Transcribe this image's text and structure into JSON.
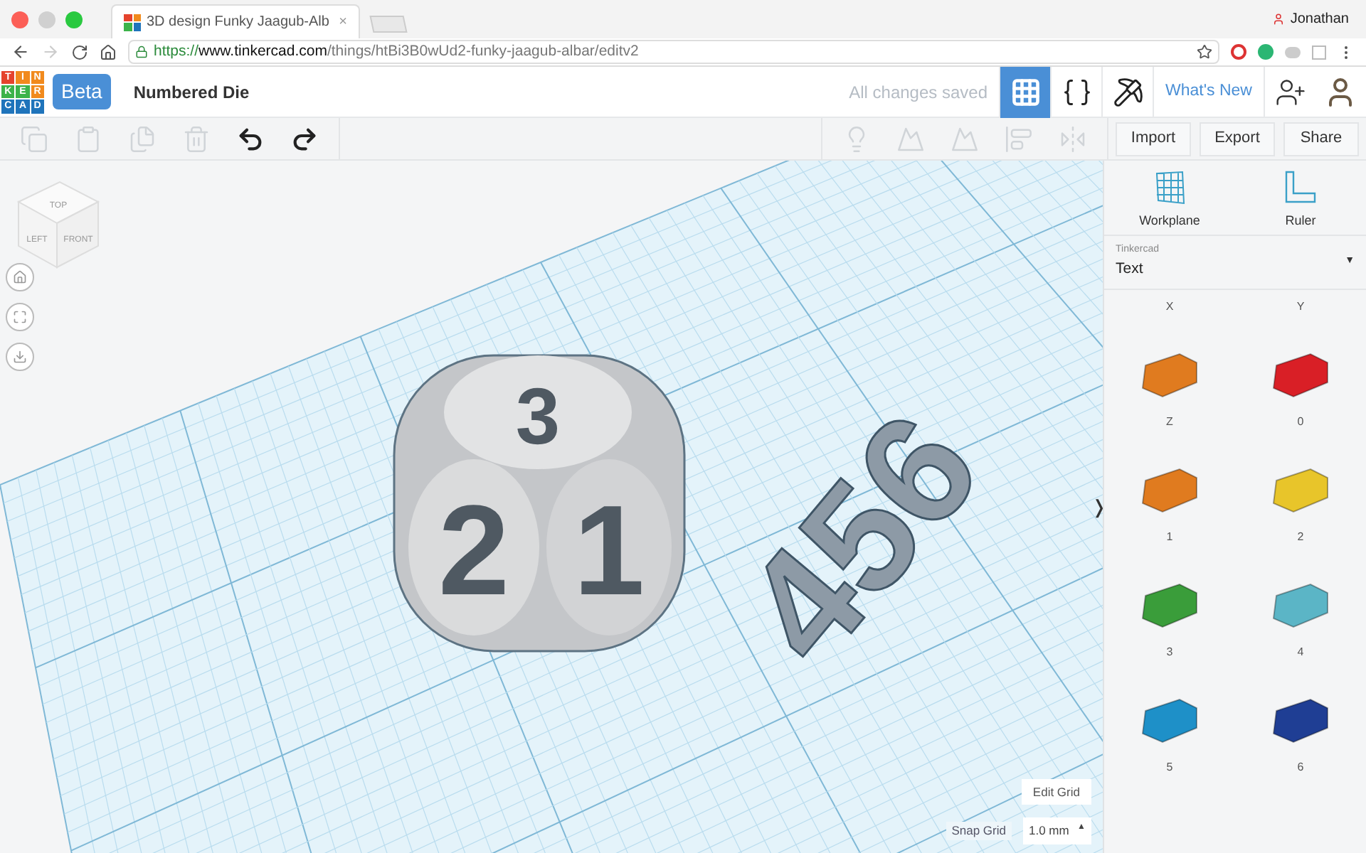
{
  "browser": {
    "tab_title": "3D design Funky Jaagub-Alb",
    "tab_close": "×",
    "profile": "Jonathan",
    "url_scheme": "https://",
    "url_host": "www.tinkercad.com",
    "url_path": "/things/htBi3B0wUd2-funky-jaagub-albar/editv2",
    "forward_disabled": true
  },
  "header": {
    "logo_letters": [
      "T",
      "I",
      "N",
      "K",
      "E",
      "R",
      "C",
      "A",
      "D"
    ],
    "badge": "Beta",
    "title": "Numbered Die",
    "save_status": "All changes saved",
    "whats_new": "What's New",
    "views": [
      {
        "kind": "grid",
        "selected": true
      },
      {
        "kind": "code",
        "selected": false
      },
      {
        "kind": "pickaxe",
        "selected": false
      }
    ]
  },
  "toolbar": {
    "edit_tools": [
      {
        "kind": "copy",
        "disabled": true
      },
      {
        "kind": "paste",
        "disabled": true
      },
      {
        "kind": "duplicate",
        "disabled": true
      },
      {
        "kind": "delete",
        "disabled": true
      },
      {
        "kind": "undo",
        "disabled": false
      },
      {
        "kind": "redo",
        "disabled": false
      }
    ],
    "shape_tools": [
      {
        "kind": "bulb",
        "disabled": true
      },
      {
        "kind": "solid",
        "disabled": true
      },
      {
        "kind": "hole",
        "disabled": true
      },
      {
        "kind": "align",
        "disabled": true
      },
      {
        "kind": "mirror",
        "disabled": true
      }
    ],
    "actions": [
      "Import",
      "Export",
      "Share"
    ]
  },
  "canvas": {
    "view_cube": [
      "TOP",
      "LEFT",
      "FRONT"
    ],
    "die_faces": [
      "3",
      "2",
      "1"
    ],
    "loose_digits": "456",
    "edit_grid": "Edit Grid",
    "snap_grid_label": "Snap Grid",
    "snap_grid_value": "1.0 mm",
    "snap_caret": "▲",
    "collapse": "❭"
  },
  "panel": {
    "tools": [
      "Workplane",
      "Ruler"
    ],
    "library_source": "Tinkercad",
    "library": "Text",
    "library_caret": "▼",
    "shapes": [
      {
        "label": "X",
        "kind": "label"
      },
      {
        "label": "Y",
        "kind": "label"
      },
      {
        "label": "Z",
        "kind": "shape",
        "color": "#e07b1f"
      },
      {
        "label": "0",
        "kind": "shape",
        "color": "#d91f26"
      },
      {
        "label": "1",
        "kind": "shape",
        "color": "#e07b1f"
      },
      {
        "label": "2",
        "kind": "shape",
        "color": "#e8c52a"
      },
      {
        "label": "3",
        "kind": "shape",
        "color": "#3a9d3a"
      },
      {
        "label": "4",
        "kind": "shape",
        "color": "#5bb5c6"
      },
      {
        "label": "5",
        "kind": "shape",
        "color": "#1e90c8"
      },
      {
        "label": "6",
        "kind": "shape",
        "color": "#1f3e94"
      }
    ]
  }
}
